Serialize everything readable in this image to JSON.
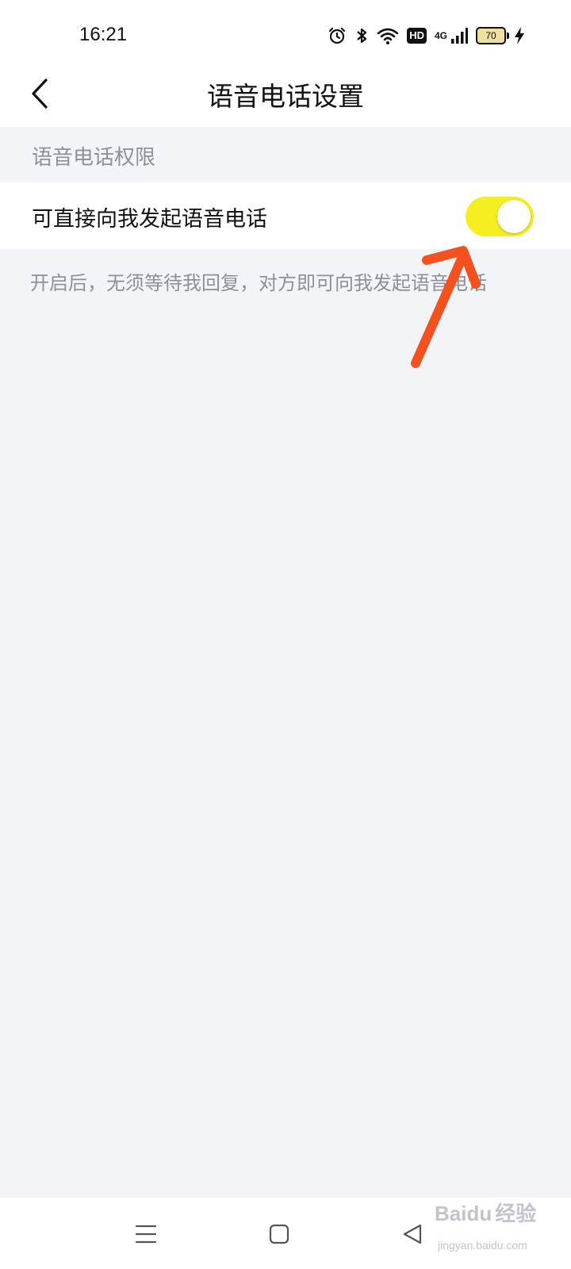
{
  "status_bar": {
    "time": "16:21",
    "hd_label": "HD",
    "network_label": "4G",
    "battery_level": "70"
  },
  "header": {
    "title": "语音电话设置"
  },
  "section": {
    "title": "语音电话权限"
  },
  "setting": {
    "label": "可直接向我发起语音电话",
    "enabled": true,
    "description": "开启后，无须等待我回复，对方即可向我发起语音电话"
  },
  "watermark": {
    "brand": "Bai",
    "brand2": "du",
    "brand3": "经验",
    "url": "jingyan.baidu.com"
  },
  "colors": {
    "toggle_on": "#f5ef21",
    "arrow": "#f4511e",
    "page_background": "#f3f4f8",
    "secondary_text": "#8e8f99"
  }
}
